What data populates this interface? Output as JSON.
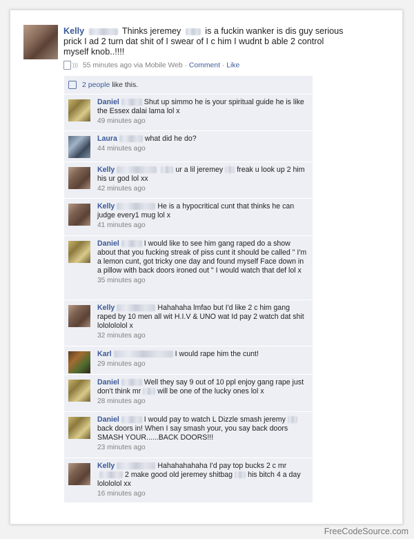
{
  "post": {
    "author": "Kelly",
    "text": "Thinks jeremey",
    "text_after": "is a fuckin wanker is dis guy serious prick I ad 2 turn dat shit of I swear of I c him I wudnt b able 2 control myself knob..!!!!",
    "time": "55 minutes ago via Mobile Web",
    "sep1": "·",
    "comment_link": "Comment",
    "sep2": "·",
    "like_link": "Like"
  },
  "likes": {
    "count_link": "2 people",
    "suffix": "like this."
  },
  "comments": [
    {
      "name": "Daniel",
      "text": "Shut up simmo he is your spiritual guide he is like the Essex dalai lama lol x",
      "time": "49 minutes ago"
    },
    {
      "name": "Laura",
      "text": "what did he do?",
      "time": "44 minutes ago"
    },
    {
      "name": "Kelly",
      "text": "ur a lil jeremey",
      "text2": "freak u look up 2 him his ur god lol xx",
      "time": "42 minutes ago"
    },
    {
      "name": "Kelly",
      "text": "He is a hypocritical cunt that thinks he can judge every1 mug lol x",
      "time": "41 minutes ago"
    },
    {
      "name": "Daniel",
      "text": "I would like to see him gang raped do a show about that you fucking streak of piss cunt it should be called \" I'm a lemon cunt, got tricky one day and found myself Face down in a pillow with back doors ironed out \" I would watch that def lol x",
      "time": "35 minutes ago"
    },
    {
      "name": "Kelly",
      "text": "Hahahaha lmfao but I'd like 2 c him gang raped by 10 men all wit H.I.V & UNO wat Id pay 2 watch dat shit lololololol x",
      "time": "32 minutes ago"
    },
    {
      "name": "Karl",
      "text": "I would rape him the cunt!",
      "time": "29 minutes ago"
    },
    {
      "name": "Daniel",
      "text": "Well they say 9 out of 10 ppl enjoy gang rape just don't think mr",
      "text2": "will be one of the lucky ones lol x",
      "time": "28 minutes ago"
    },
    {
      "name": "Daniel",
      "text": "I would pay to watch L Dizzle smash jeremy",
      "text2": "back doors in! When I say smash your, you say back doors SMASH YOUR......BACK DOORS!!!",
      "time": "23 minutes ago"
    },
    {
      "name": "Kelly",
      "text": "Hahahahahaha I'd pay top bucks 2 c mr",
      "text2": "2 make good old jeremey shitbag",
      "text3": "his bitch 4 a day lolololol xx",
      "time": "16 minutes ago"
    }
  ],
  "watermark": "FreeCodeSource.com",
  "colors": {
    "link": "#3b5998",
    "thread_bg": "#edeff4"
  }
}
